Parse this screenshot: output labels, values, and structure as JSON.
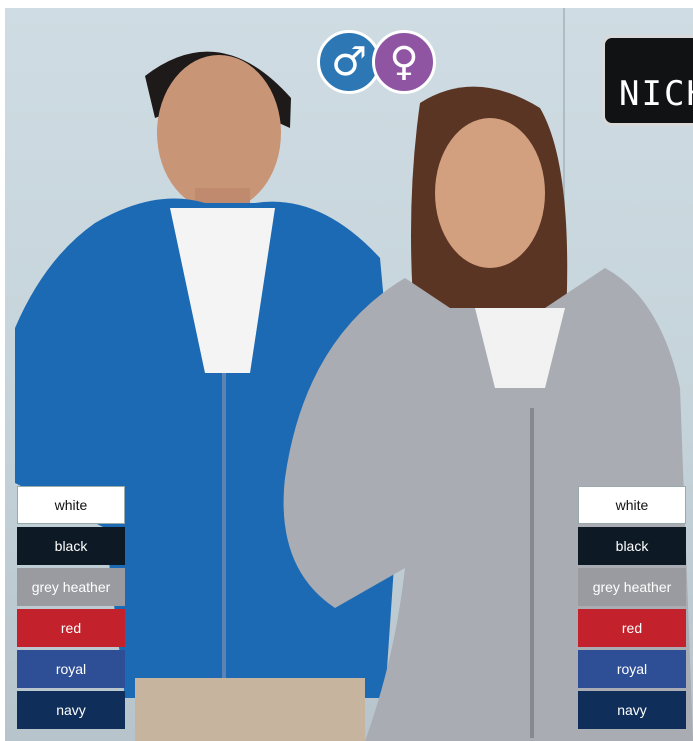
{
  "header": {
    "gender_icons": [
      {
        "name": "male-icon",
        "glyph": "♂",
        "color": "#2d77b5"
      },
      {
        "name": "female-icon",
        "glyph": "♀",
        "color": "#9055a2"
      }
    ],
    "logo_text": "NICH"
  },
  "swatches_left": [
    {
      "label": "white",
      "color": "#ffffff"
    },
    {
      "label": "black",
      "color": "#0d1a26"
    },
    {
      "label": "grey heather",
      "color": "#9a9ba0"
    },
    {
      "label": "red",
      "color": "#c3222c"
    },
    {
      "label": "royal",
      "color": "#2e4f96"
    },
    {
      "label": "navy",
      "color": "#0f2f5a"
    }
  ],
  "swatches_right": [
    {
      "label": "white",
      "color": "#ffffff"
    },
    {
      "label": "black",
      "color": "#0d1a26"
    },
    {
      "label": "grey heather",
      "color": "#9a9ba0"
    },
    {
      "label": "red",
      "color": "#c3222c"
    },
    {
      "label": "royal",
      "color": "#2e4f96"
    },
    {
      "label": "navy",
      "color": "#0f2f5a"
    }
  ]
}
